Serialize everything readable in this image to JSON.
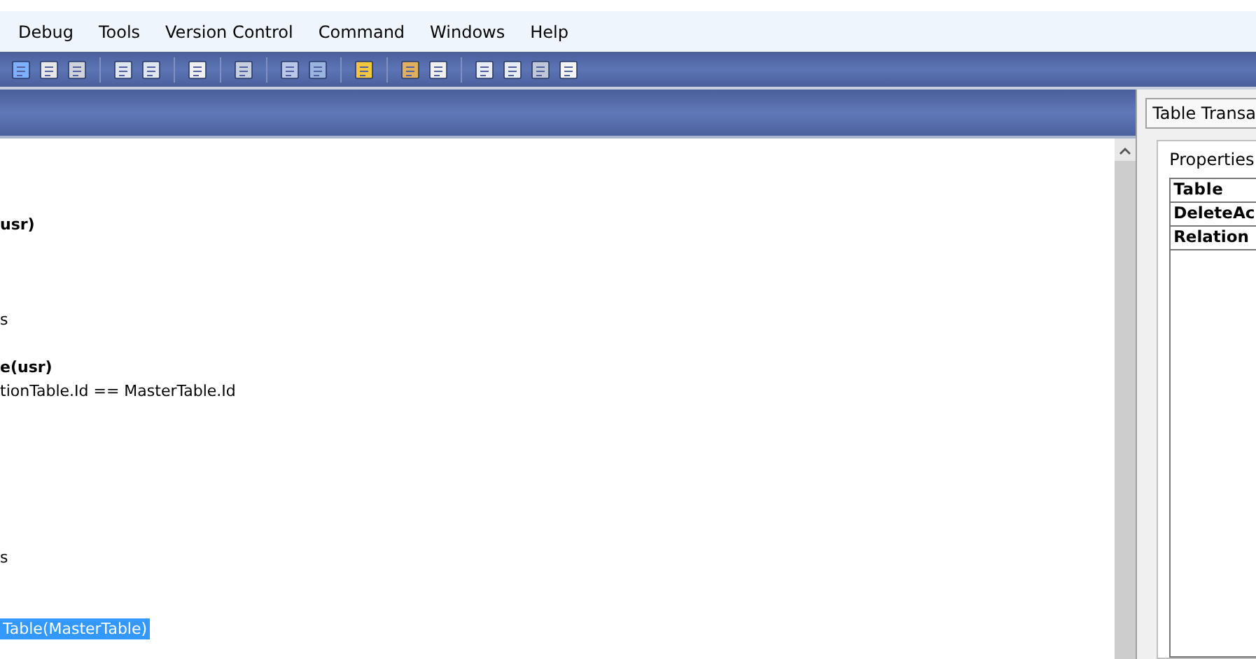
{
  "menu": [
    "Debug",
    "Tools",
    "Version Control",
    "Command",
    "Windows",
    "Help"
  ],
  "editor": {
    "lines": [
      {
        "text": "usr)",
        "bold": true,
        "selected": false
      },
      {
        "text": "s",
        "bold": false,
        "selected": false
      },
      {
        "text": "e(usr)",
        "bold": true,
        "selected": false
      },
      {
        "text": "tionTable.Id == MasterTable.Id",
        "bold": false,
        "selected": false
      },
      {
        "text": "s",
        "bold": false,
        "selected": false
      },
      {
        "text": "Table(MasterTable)",
        "bold": false,
        "selected": true
      }
    ]
  },
  "side_panel": {
    "tab": "Table Transa",
    "section": "Properties",
    "rows": [
      {
        "text": "Table",
        "kind": "header"
      },
      {
        "text": "DeleteAc",
        "kind": "row"
      },
      {
        "text": "Relation",
        "kind": "row"
      }
    ]
  }
}
